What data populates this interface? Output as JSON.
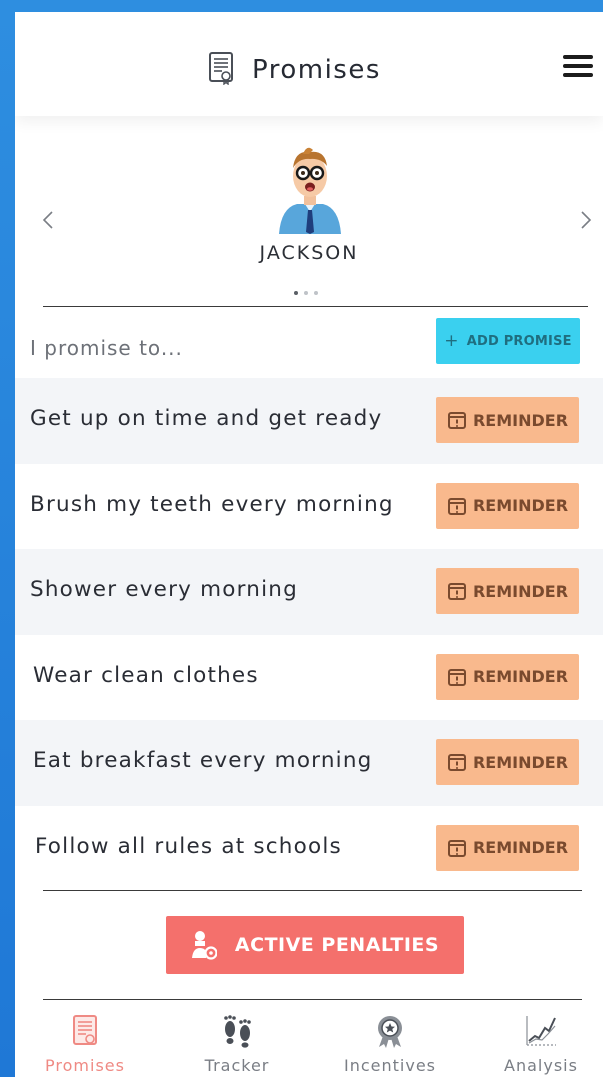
{
  "header": {
    "title": "Promises",
    "title_icon": "document-certificate-icon",
    "menu_icon": "hamburger-menu-icon"
  },
  "profile": {
    "name": "JACKSON",
    "carousel_total": 3,
    "carousel_active": 1,
    "prev_icon": "chevron-left-icon",
    "next_icon": "chevron-right-icon"
  },
  "promise_section": {
    "prompt": "I promise to...",
    "add_button": "ADD PROMISE",
    "add_icon": "plus-icon"
  },
  "promises": [
    {
      "text": "Get up on time and get ready",
      "button": "REMINDER"
    },
    {
      "text": "Brush my teeth every morning",
      "button": "REMINDER"
    },
    {
      "text": "Shower every morning",
      "button": "REMINDER"
    },
    {
      "text": "Wear clean clothes",
      "button": "REMINDER"
    },
    {
      "text": "Eat breakfast every morning",
      "button": "REMINDER"
    },
    {
      "text": "Follow all rules at schools",
      "button": "REMINDER"
    }
  ],
  "penalties_button": "ACTIVE PENALTIES",
  "nav": [
    {
      "label": "Promises",
      "icon": "document-certificate-icon",
      "active": true
    },
    {
      "label": "Tracker",
      "icon": "footprints-icon",
      "active": false
    },
    {
      "label": "Incentives",
      "icon": "award-ribbon-icon",
      "active": false
    },
    {
      "label": "Analysis",
      "icon": "line-chart-icon",
      "active": false
    }
  ],
  "colors": {
    "add_button": "#3ad0ef",
    "reminder_button": "#f9b98d",
    "penalty_button": "#f4706c",
    "active_nav": "#ef8a84",
    "alt_row": "#f3f5f8",
    "background": "#2e8ee0"
  }
}
